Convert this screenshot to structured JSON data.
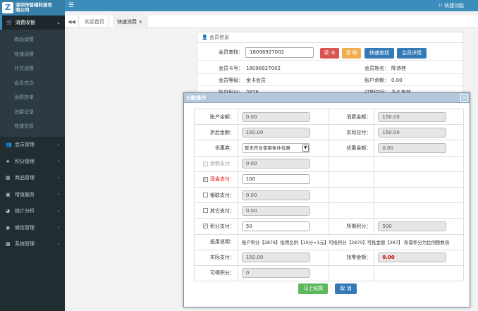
{
  "header": {
    "logo_mark": "Z",
    "logo_line1": "深圳市智络科技有",
    "logo_line2": "限公司",
    "menu_icon": "hamburger-icon",
    "shortcut_label": "快捷功能",
    "colors": {
      "topbar": "#3c8dbc",
      "sidebar": "#222d32"
    }
  },
  "sidebar": {
    "active_group": "消费收银",
    "sub_items": [
      "商品消费",
      "快速消费",
      "计次消费",
      "会员充次",
      "消费挂单",
      "消费记录",
      "快速交班"
    ],
    "groups": [
      {
        "label": "会员管理",
        "icon": "users-icon"
      },
      {
        "label": "积分管理",
        "icon": "star-icon"
      },
      {
        "label": "商品管理",
        "icon": "box-icon"
      },
      {
        "label": "增值服务",
        "icon": "gift-icon"
      },
      {
        "label": "统计分析",
        "icon": "chart-icon"
      },
      {
        "label": "微信管理",
        "icon": "wechat-icon"
      },
      {
        "label": "系统管理",
        "icon": "monitor-icon"
      }
    ]
  },
  "tabs": {
    "items": [
      {
        "label": "欢迎首页"
      },
      {
        "label": "快速消费",
        "close": "×"
      }
    ]
  },
  "member": {
    "title": "会员信息",
    "query_label": "会员查找：",
    "query_value": "18098927002",
    "buttons": {
      "read_card": "读 卡",
      "clear": "清 除",
      "quick_find": "快速查找",
      "detail": "会员详情"
    },
    "card_label": "会员卡号：",
    "card_value": "18098927002",
    "name_label": "会员姓名：",
    "name_value": "陈诗桂",
    "level_label": "会员等级：",
    "level_value": "金卡会员",
    "balance_label": "账户余额：",
    "balance_value": "0.00",
    "points_label": "账户积分：",
    "points_value": "2878",
    "expire_label": "过期时间：",
    "expire_value": "永久有效"
  },
  "modal": {
    "title": "付款操作",
    "close": "×",
    "rows": {
      "account_balance": {
        "label": "账户余额：",
        "value": "0.00"
      },
      "consume_amount": {
        "label": "消费金额：",
        "value": "150.00"
      },
      "discount_amount": {
        "label": "折后金额：",
        "value": "150.00"
      },
      "actual_due": {
        "label": "实际应付：",
        "value": "150.00"
      },
      "coupon": {
        "label": "优惠券：",
        "value": "暂无符合使用条件优惠"
      },
      "coupon_amount": {
        "label": "优惠金额：",
        "value": "0.00"
      },
      "balance_pay": {
        "label": "余额支付：",
        "value": "0.00",
        "checked": false
      },
      "cash_pay": {
        "label": "现金支付：",
        "value": "100",
        "checked": true
      },
      "unionpay_pay": {
        "label": "银联支付：",
        "value": "0.00",
        "checked": false
      },
      "other_pay": {
        "label": "其它支付：",
        "value": "0.00",
        "checked": false
      },
      "points_pay": {
        "label": "积分支付：",
        "value": "50",
        "checked": true
      },
      "points_needed": {
        "label": "所需积分：",
        "value": "500"
      },
      "points_note": {
        "label": "抵用说明：",
        "value": "账户积分【2878】抵用比例【10分=1元】可抵积分【2870】可抵金额【287】 所需积分为比例整数倍"
      },
      "actual_pay": {
        "label": "实际支付：",
        "value": "150.00"
      },
      "change_amount": {
        "label": "找零金额：",
        "value": "0.00"
      },
      "earn_points": {
        "label": "可得积分：",
        "value": "0"
      }
    },
    "confirm": "马上结算",
    "cancel": "取 消"
  }
}
